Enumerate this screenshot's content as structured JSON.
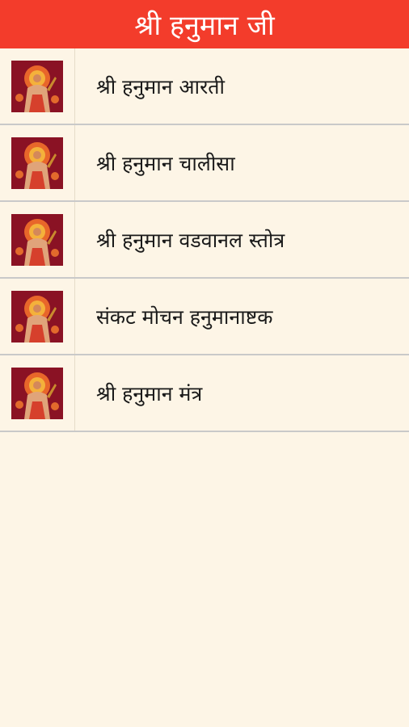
{
  "app": {
    "title": "श्री हनुमान जी"
  },
  "menu": {
    "items": [
      {
        "label": "श्री हनुमान आरती",
        "icon": "hanuman-image-icon"
      },
      {
        "label": "श्री हनुमान चालीसा",
        "icon": "hanuman-image-icon"
      },
      {
        "label": "श्री हनुमान वडवानल स्तोत्र",
        "icon": "hanuman-image-icon"
      },
      {
        "label": "संकट मोचन हनुमानाष्टक",
        "icon": "hanuman-image-icon"
      },
      {
        "label": "श्री हनुमान मंत्र",
        "icon": "hanuman-image-icon"
      }
    ]
  },
  "colors": {
    "header_bg": "#f33c2b",
    "page_bg": "#fdf5e6",
    "divider": "#c9c9c9"
  }
}
